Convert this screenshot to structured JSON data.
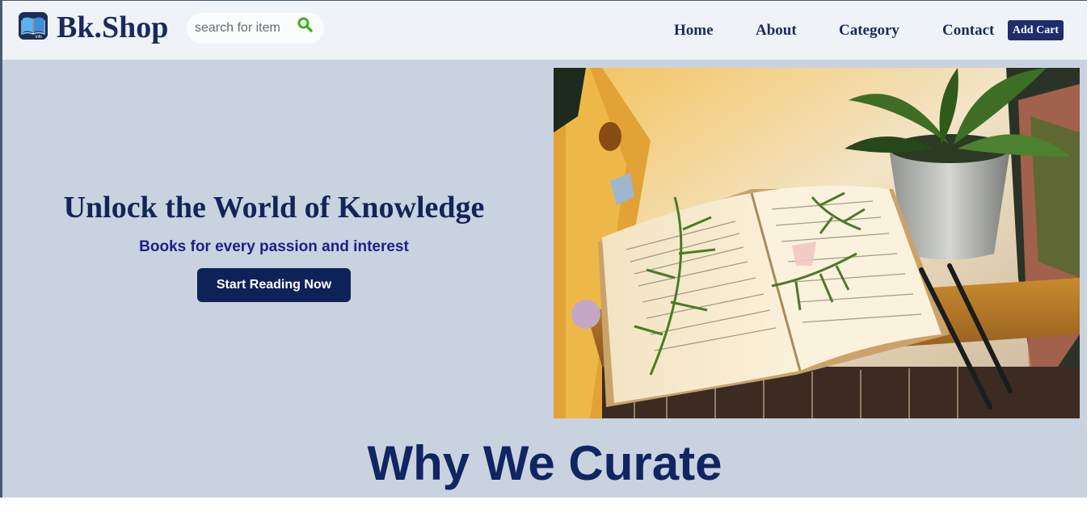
{
  "brand": {
    "name": "Bk.Shop",
    "logo_badge": "info"
  },
  "search": {
    "placeholder": "search for item"
  },
  "nav": {
    "links": [
      "Home",
      "About",
      "Category",
      "Contact"
    ],
    "cart_label": "Add Cart"
  },
  "hero": {
    "title": "Unlock the World of Knowledge",
    "subtitle": "Books for every passion and interest",
    "cta_label": "Start Reading Now",
    "image_icon": "open-book-with-plants-photo"
  },
  "section": {
    "title": "Why We Curate"
  },
  "colors": {
    "navy": "#14245a",
    "cta_bg": "#0f2258",
    "hero_bg": "#c9d3e0",
    "navbar_bg": "#eff3f8",
    "search_icon": "#3fae1f",
    "subtitle": "#1c1f8a"
  }
}
